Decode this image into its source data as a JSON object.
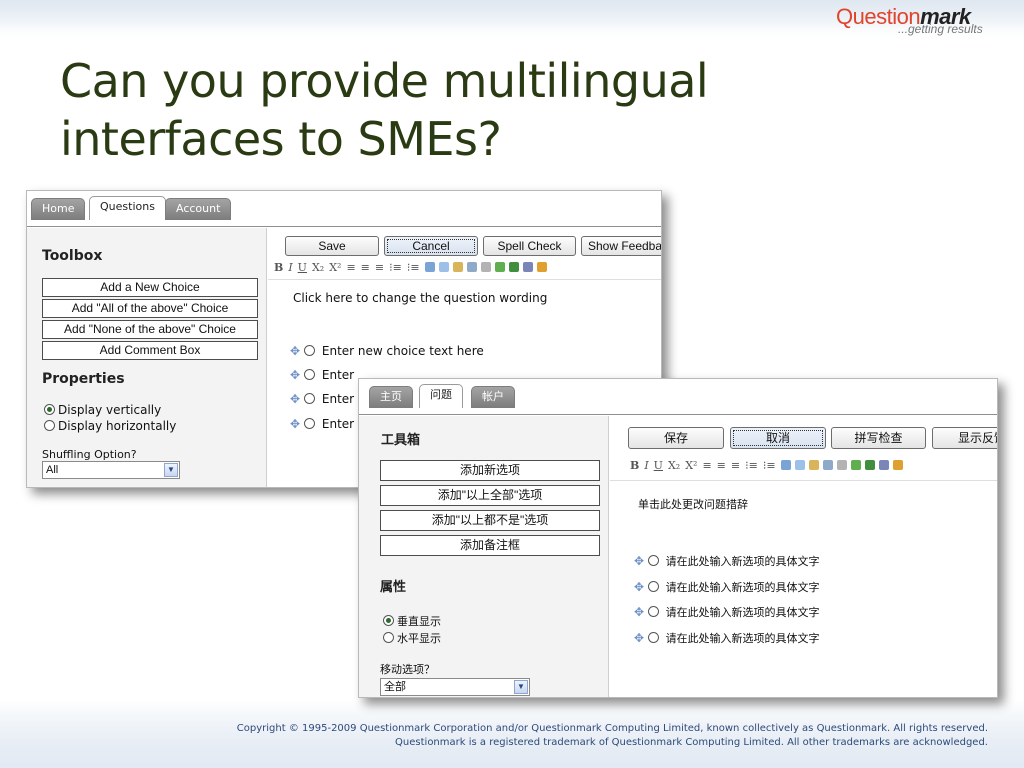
{
  "logo": {
    "brand_part1": "Question",
    "brand_part2": "mark",
    "tagline": "...getting results"
  },
  "title": "Can you provide multilingual interfaces to SMEs?",
  "english_ui": {
    "tabs": [
      "Home",
      "Questions",
      "Account"
    ],
    "toolbox_heading": "Toolbox",
    "toolbox_buttons": [
      "Add a New Choice",
      "Add \"All of the above\" Choice",
      "Add \"None of the above\" Choice",
      "Add Comment Box"
    ],
    "properties_heading": "Properties",
    "display_options": [
      "Display vertically",
      "Display horizontally"
    ],
    "shuffling_label": "Shuffling Option?",
    "shuffling_value": "All",
    "action_buttons": [
      "Save",
      "Cancel",
      "Spell Check",
      "Show Feedback"
    ],
    "question_prompt": "Click here to change the question wording",
    "choices": [
      "Enter new choice text here",
      "Enter",
      "Enter",
      "Enter"
    ]
  },
  "chinese_ui": {
    "tabs": [
      "主页",
      "问题",
      "帐户"
    ],
    "toolbox_heading": "工具箱",
    "toolbox_buttons": [
      "添加新选项",
      "添加\"以上全部\"选项",
      "添加\"以上都不是\"选项",
      "添加备注框"
    ],
    "properties_heading": "属性",
    "display_options": [
      "垂直显示",
      "水平显示"
    ],
    "shuffling_label": "移动选项？",
    "shuffling_value": "全部",
    "action_buttons": [
      "保存",
      "取消",
      "拼写检查",
      "显示反馈"
    ],
    "question_prompt": "单击此处更改问题措辞",
    "choices": [
      "请在此处输入新选项的具体文字",
      "请在此处输入新选项的具体文字",
      "请在此处输入新选项的具体文字",
      "请在此处输入新选项的具体文字"
    ]
  },
  "editor_toolbar": [
    "B",
    "I",
    "U",
    "X₂",
    "X²",
    "≡",
    "≡",
    "≡",
    "⁝≡",
    "⁝≡"
  ],
  "copyright": {
    "line1": "Copyright © 1995-2009 Questionmark Corporation and/or Questionmark Computing Limited, known collectively as Questionmark. All rights reserved.",
    "line2": "Questionmark is a registered trademark of Questionmark Computing Limited. All other trademarks are acknowledged."
  }
}
